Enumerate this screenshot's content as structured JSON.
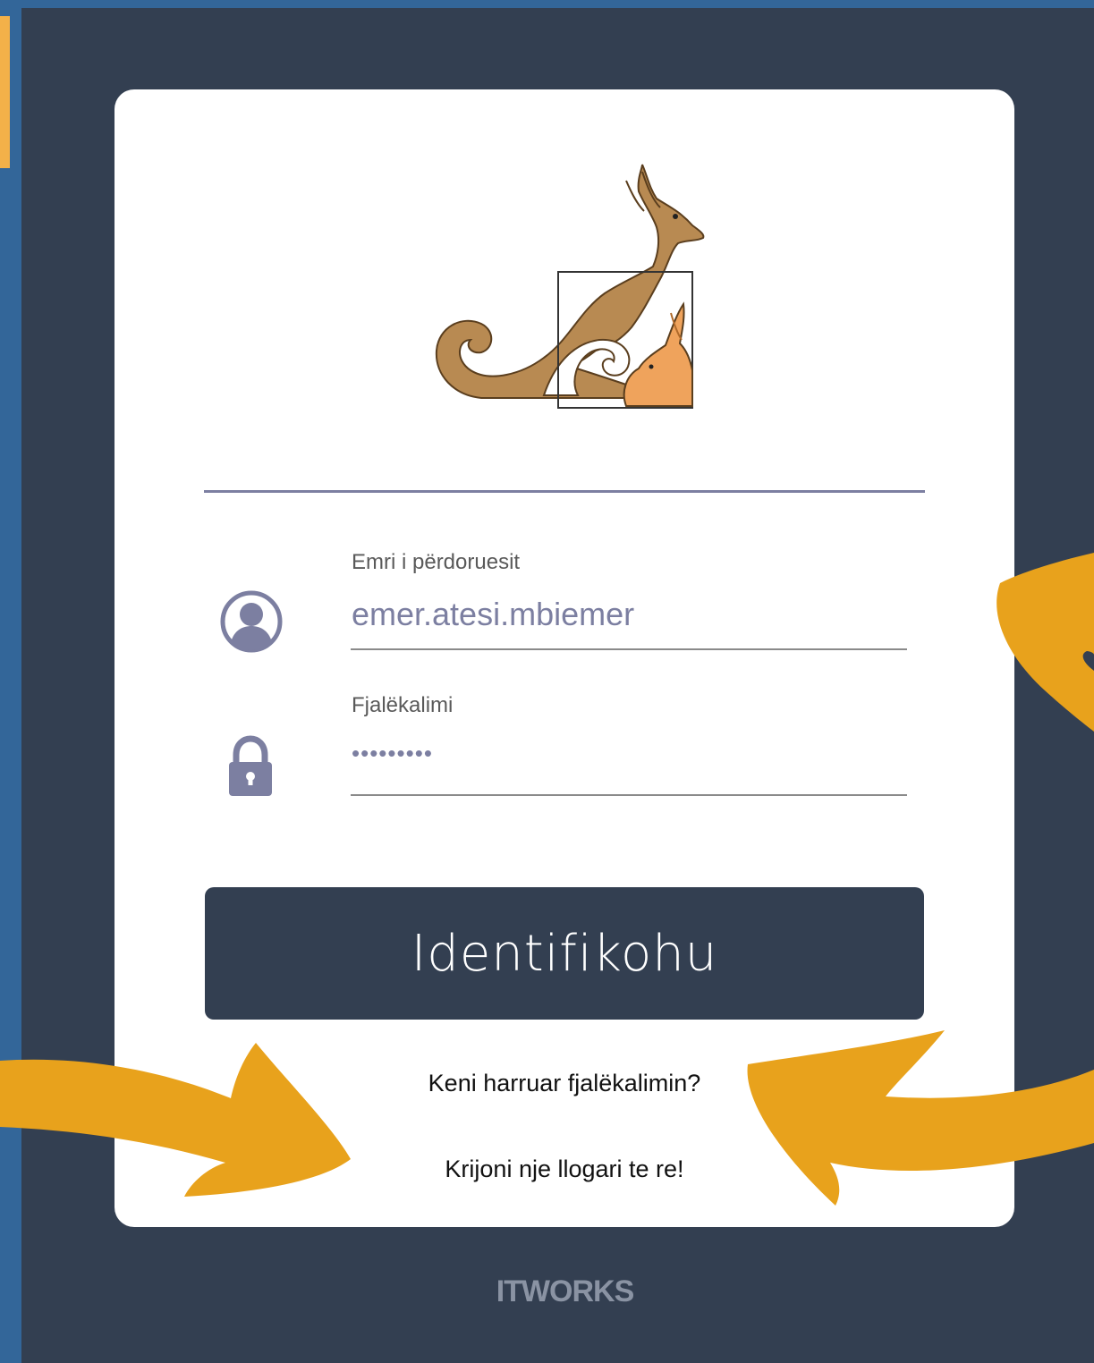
{
  "login": {
    "username": {
      "label": "Emri i përdoruesit",
      "value": "emer.atesi.mbiemer",
      "icon": "user-icon"
    },
    "password": {
      "label": "Fjalëkalimi",
      "value": "•••••••••",
      "icon": "lock-icon"
    },
    "submit_label": "Identifikohu",
    "forgot_password_link": "Keni harruar fjalëkalimin?",
    "create_account_link": "Krijoni nje llogari te re!"
  },
  "footer": {
    "brand": "ITWORKS"
  },
  "colors": {
    "background": "#333f51",
    "outer_frame": "#336699",
    "card": "#ffffff",
    "accent_arrows": "#e8a21c",
    "input_text": "#7c7fa1",
    "button": "#333f51"
  },
  "decorations": {
    "logo": "kangaroo-logo",
    "annotation_arrows": [
      "arrow-to-username",
      "arrow-to-create-account",
      "arrow-to-forgot-password"
    ]
  }
}
